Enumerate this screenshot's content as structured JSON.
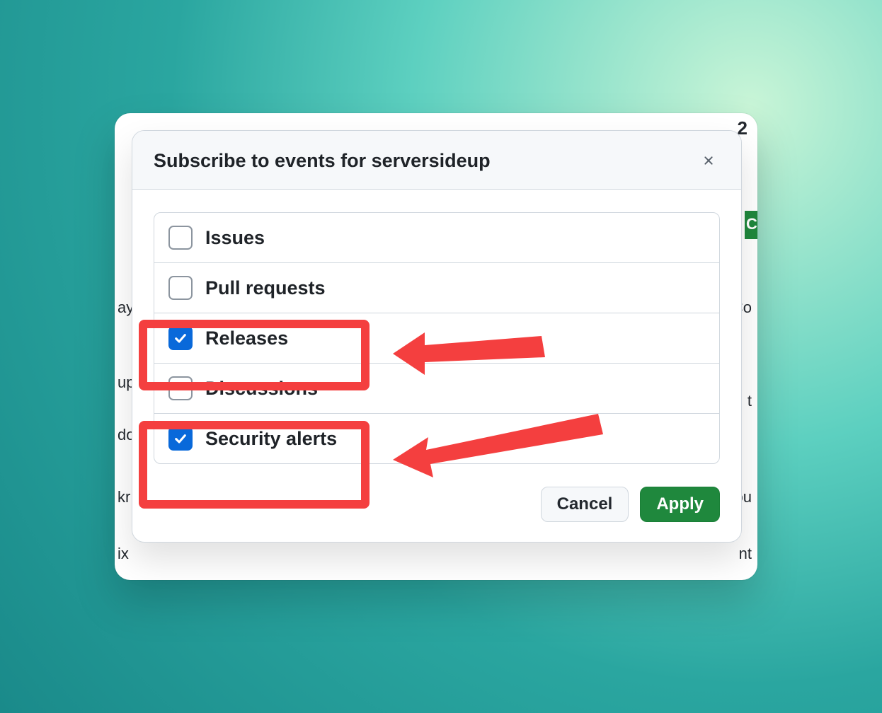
{
  "background": {
    "badge_number": "2",
    "green_fragment": "C",
    "side_texts": [
      "ay",
      "up",
      "do",
      "kr",
      "ix"
    ],
    "right_texts": [
      "Co",
      "t",
      "ou",
      "nt"
    ]
  },
  "dialog": {
    "title": "Subscribe to events for serversideup",
    "options": [
      {
        "label": "Issues",
        "checked": false
      },
      {
        "label": "Pull requests",
        "checked": false
      },
      {
        "label": "Releases",
        "checked": true
      },
      {
        "label": "Discussions",
        "checked": false
      },
      {
        "label": "Security alerts",
        "checked": true
      }
    ],
    "cancel_label": "Cancel",
    "apply_label": "Apply"
  },
  "annotations": {
    "highlight_color": "#f43f3f"
  }
}
